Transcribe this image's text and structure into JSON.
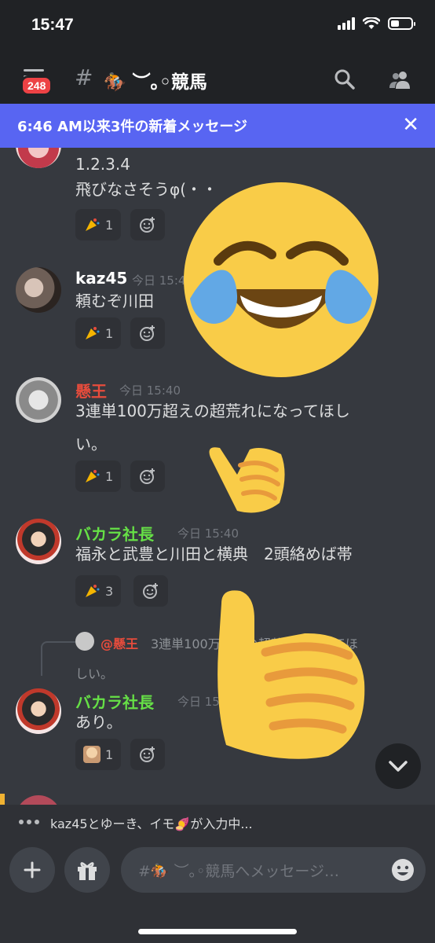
{
  "status_bar": {
    "time": "15:47"
  },
  "header": {
    "unread_badge": "248",
    "channel_hash": "#",
    "channel_name": "🏇 ︶｡◦競馬"
  },
  "banner": {
    "text": "6:46 AM以来3件の新着メッセージ"
  },
  "messages": [
    {
      "author": "",
      "timestamp": "",
      "lines": [
        "1.2.3.4",
        "飛びなさそうφ(・・"
      ],
      "reaction_count": "1"
    },
    {
      "author": "kaz45",
      "author_color": "#ffffff",
      "timestamp": "今日 15:40",
      "lines": [
        "頼むぞ川田"
      ],
      "reaction_count": "1"
    },
    {
      "author": "懸王",
      "author_color": "#e74c3c",
      "timestamp": "今日 15:40",
      "lines": [
        "3連単100万超えの超荒れになってほし",
        "い。"
      ],
      "reaction_count": "1"
    },
    {
      "author": "バカラ社長",
      "author_color": "#66e046",
      "timestamp": "今日 15:40",
      "lines": [
        "福永と武豊と川田と横典　2頭絡めば帯"
      ],
      "reaction_count": "3"
    },
    {
      "reply_mention": "@懸王",
      "reply_text_1": "3連単100万超えの超荒れになってほ",
      "reply_text_2": "しい。",
      "author": "バカラ社長",
      "author_color": "#66e046",
      "timestamp": "今日 15:40",
      "lines": [
        "あり。"
      ],
      "reaction_count": "1"
    }
  ],
  "typing": {
    "text": "kaz45とゆーき、イモ🍠が入力中..."
  },
  "composer": {
    "placeholder": "#🏇 ︶｡◦競馬へメッセージ…"
  },
  "icons": {
    "search": "search-icon",
    "members": "members-icon",
    "close": "close-icon",
    "reaction_emoji": "party-popper-icon",
    "add_reaction": "add-reaction-icon",
    "scroll": "chevron-down-icon",
    "plus": "plus-icon",
    "gift": "gift-icon",
    "emoji": "emoji-icon",
    "laugh_sticker": "tears-of-joy-icon",
    "thumbs_sticker": "thumbs-up-icon"
  },
  "colors": {
    "accent": "#5865f2",
    "background": "#36393f",
    "dark": "#202225",
    "danger": "#ed4245"
  }
}
